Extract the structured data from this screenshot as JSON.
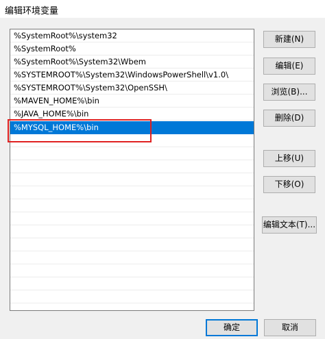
{
  "window": {
    "title": "编辑环境变量"
  },
  "list": {
    "items": [
      {
        "text": "%SystemRoot%\\system32",
        "selected": false
      },
      {
        "text": "%SystemRoot%",
        "selected": false
      },
      {
        "text": "%SystemRoot%\\System32\\Wbem",
        "selected": false
      },
      {
        "text": "%SYSTEMROOT%\\System32\\WindowsPowerShell\\v1.0\\",
        "selected": false
      },
      {
        "text": "%SYSTEMROOT%\\System32\\OpenSSH\\",
        "selected": false
      },
      {
        "text": "%MAVEN_HOME%\\bin",
        "selected": false
      },
      {
        "text": "%JAVA_HOME%\\bin",
        "selected": false
      },
      {
        "text": "%MYSQL_HOME%\\bin",
        "selected": true
      }
    ]
  },
  "buttons": {
    "new": "新建(N)",
    "edit": "编辑(E)",
    "browse": "浏览(B)...",
    "delete": "删除(D)",
    "move_up": "上移(U)",
    "move_down": "下移(O)",
    "edit_text": "编辑文本(T)...",
    "ok": "确定",
    "cancel": "取消"
  },
  "colors": {
    "selection": "#0078d7",
    "annotation": "#e02020"
  }
}
